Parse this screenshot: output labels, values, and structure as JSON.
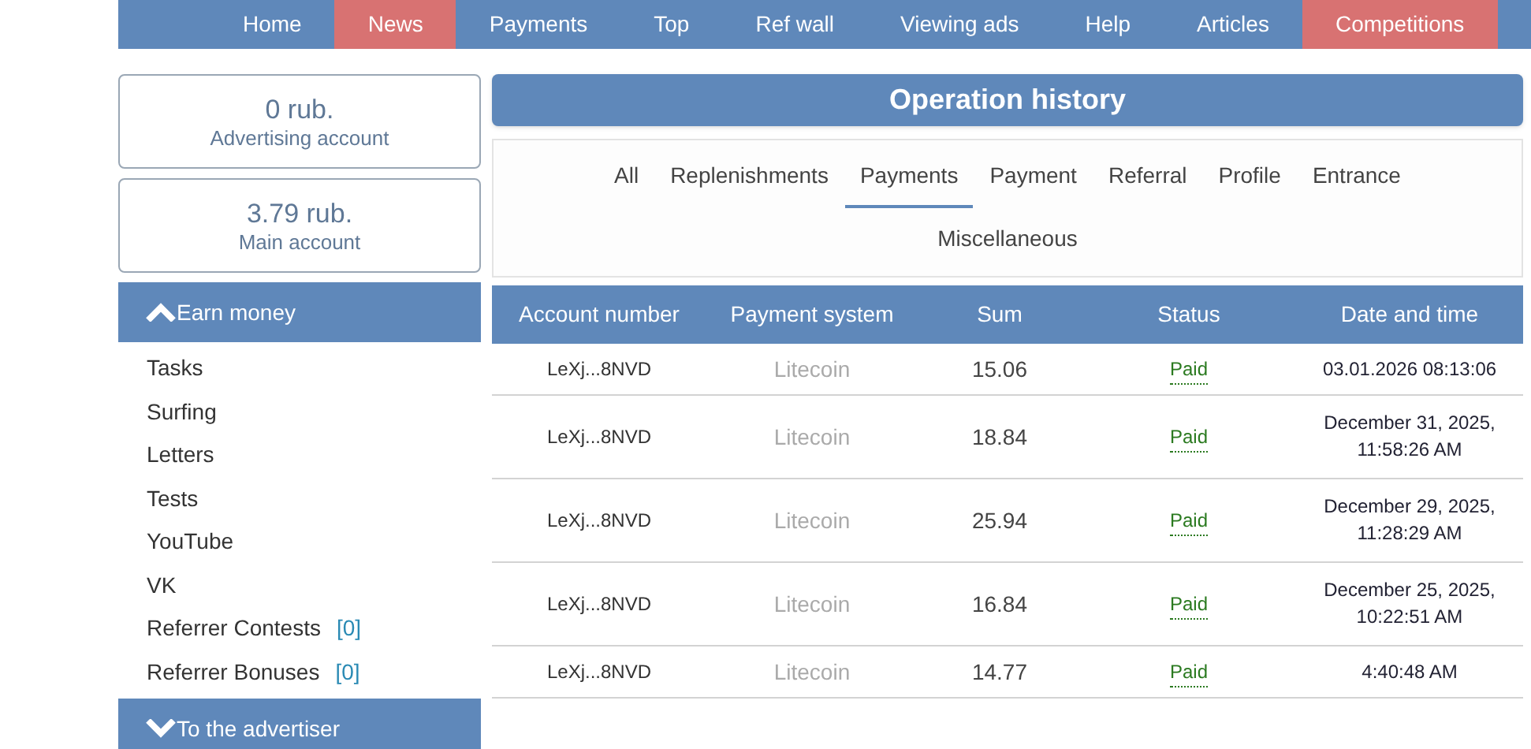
{
  "nav": [
    {
      "label": "Home",
      "color": "#5f88ba"
    },
    {
      "label": "News",
      "color": "#d87272"
    },
    {
      "label": "Payments",
      "color": "#5f88ba"
    },
    {
      "label": "Top",
      "color": "#5f88ba"
    },
    {
      "label": "Ref wall",
      "color": "#5f88ba"
    },
    {
      "label": "Viewing ads",
      "color": "#5f88ba"
    },
    {
      "label": "Help",
      "color": "#5f88ba"
    },
    {
      "label": "Articles",
      "color": "#5f88ba"
    },
    {
      "label": "Competitions",
      "color": "#d87272"
    }
  ],
  "balances": [
    {
      "amount": "0 rub.",
      "label": "Advertising account"
    },
    {
      "amount": "3.79 rub.",
      "label": "Main account"
    }
  ],
  "sidebar": [
    {
      "title": "Earn money",
      "expanded": true,
      "items": [
        {
          "label": "Tasks"
        },
        {
          "label": "Surfing"
        },
        {
          "label": "Letters"
        },
        {
          "label": "Tests"
        },
        {
          "label": "YouTube"
        },
        {
          "label": "VK"
        },
        {
          "label": "Referrer Contests",
          "count": "[0]"
        },
        {
          "label": "Referrer Bonuses",
          "count": "[0]"
        }
      ]
    },
    {
      "title": "To the advertiser",
      "expanded": false
    }
  ],
  "page_title": "Operation history",
  "tabs": [
    {
      "label": "All",
      "selected": false
    },
    {
      "label": "Replenishments",
      "selected": false
    },
    {
      "label": "Payments",
      "selected": true
    },
    {
      "label": "Payment",
      "selected": false
    },
    {
      "label": "Referral",
      "selected": false
    },
    {
      "label": "Profile",
      "selected": false
    },
    {
      "label": "Entrance",
      "selected": false
    },
    {
      "label": "Miscellaneous",
      "selected": false
    }
  ],
  "table": {
    "columns": [
      "Account number",
      "Payment system",
      "Sum",
      "Status",
      "Date and time"
    ],
    "rows": [
      {
        "account": "LeXj...8NVD",
        "system": "Litecoin",
        "sum": "15.06",
        "status": "Paid",
        "date": [
          "03.01.2026 08:13:06"
        ]
      },
      {
        "account": "LeXj...8NVD",
        "system": "Litecoin",
        "sum": "18.84",
        "status": "Paid",
        "date": [
          "December 31, 2025,",
          "11:58:26 AM"
        ]
      },
      {
        "account": "LeXj...8NVD",
        "system": "Litecoin",
        "sum": "25.94",
        "status": "Paid",
        "date": [
          "December 29, 2025,",
          "11:28:29 AM"
        ]
      },
      {
        "account": "LeXj...8NVD",
        "system": "Litecoin",
        "sum": "16.84",
        "status": "Paid",
        "date": [
          "December 25, 2025,",
          "10:22:51 AM"
        ]
      },
      {
        "account": "LeXj...8NVD",
        "system": "Litecoin",
        "sum": "14.77",
        "status": "Paid",
        "date": [
          "4:40:48 AM"
        ]
      }
    ]
  }
}
